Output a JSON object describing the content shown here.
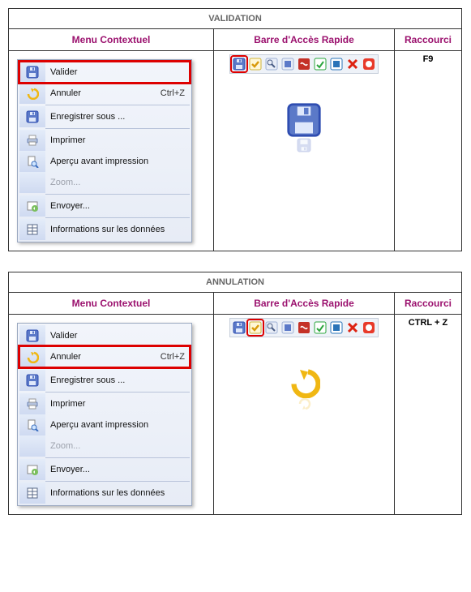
{
  "tables": {
    "validation": {
      "title": "VALIDATION",
      "col_menu": "Menu Contextuel",
      "col_bar": "Barre d'Accès Rapide",
      "col_shortcut": "Raccourci",
      "shortcut": "F9"
    },
    "annulation": {
      "title": "ANNULATION",
      "col_menu": "Menu Contextuel",
      "col_bar": "Barre d'Accès Rapide",
      "col_shortcut": "Raccourci",
      "shortcut": "CTRL + Z"
    }
  },
  "menu": {
    "valider": "Valider",
    "annuler": "Annuler",
    "annuler_sc": "Ctrl+Z",
    "enregistrer": "Enregistrer sous ...",
    "imprimer": "Imprimer",
    "apercu": "Aperçu avant impression",
    "zoom": "Zoom...",
    "envoyer": "Envoyer...",
    "infos": "Informations sur les données"
  },
  "icons": {
    "save": "save-icon",
    "undo": "undo-icon",
    "folder": "folder-icon",
    "printer": "printer-icon",
    "preview": "preview-icon",
    "send": "send-icon",
    "table": "table-icon",
    "check": "check-icon",
    "tool": "tool-icon",
    "pdf": "pdf-icon",
    "green": "green-icon",
    "blue": "blue-icon",
    "close": "close-icon",
    "stop": "stop-icon"
  }
}
